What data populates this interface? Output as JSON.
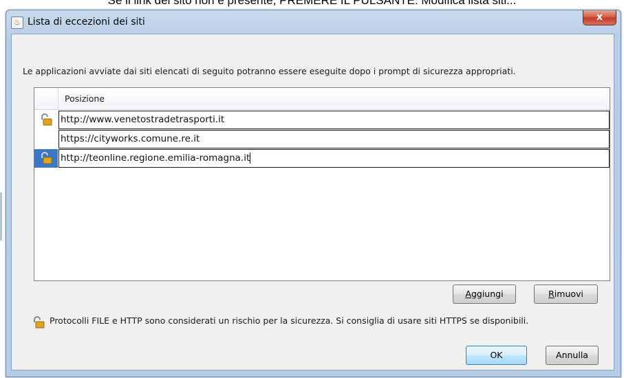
{
  "caption_above": "Se il link del sito non è presente, PREMERE IL PULSANTE: Modifica lista siti...",
  "window": {
    "title": "Lista di eccezioni dei siti",
    "close_label": "x"
  },
  "description": "Le applicazioni avviate dai siti elencati di seguito potranno essere eseguite dopo i prompt di sicurezza appropriati.",
  "table": {
    "column_header": "Posizione",
    "rows": [
      {
        "url": "http://www.venetostradetrasporti.it",
        "icon": "padlock-icon",
        "selected": false
      },
      {
        "url": "https://cityworks.comune.re.it",
        "icon": "",
        "selected": false
      },
      {
        "url": "http://teonline.regione.emilia-romagna.it",
        "icon": "padlock-icon",
        "selected": true
      }
    ]
  },
  "buttons": {
    "add_mnemonic": "A",
    "add_rest": "ggiungi",
    "remove_mnemonic": "R",
    "remove_rest": "imuovi",
    "ok": "OK",
    "cancel": "Annulla"
  },
  "warning": {
    "icon": "padlock-icon",
    "text": "Protocolli FILE e HTTP sono considerati un rischio per la sicurezza.  Si consiglia di usare siti HTTPS se disponibili."
  },
  "colors": {
    "selection": "#3a77c8",
    "lock_body": "#e0a51e"
  }
}
